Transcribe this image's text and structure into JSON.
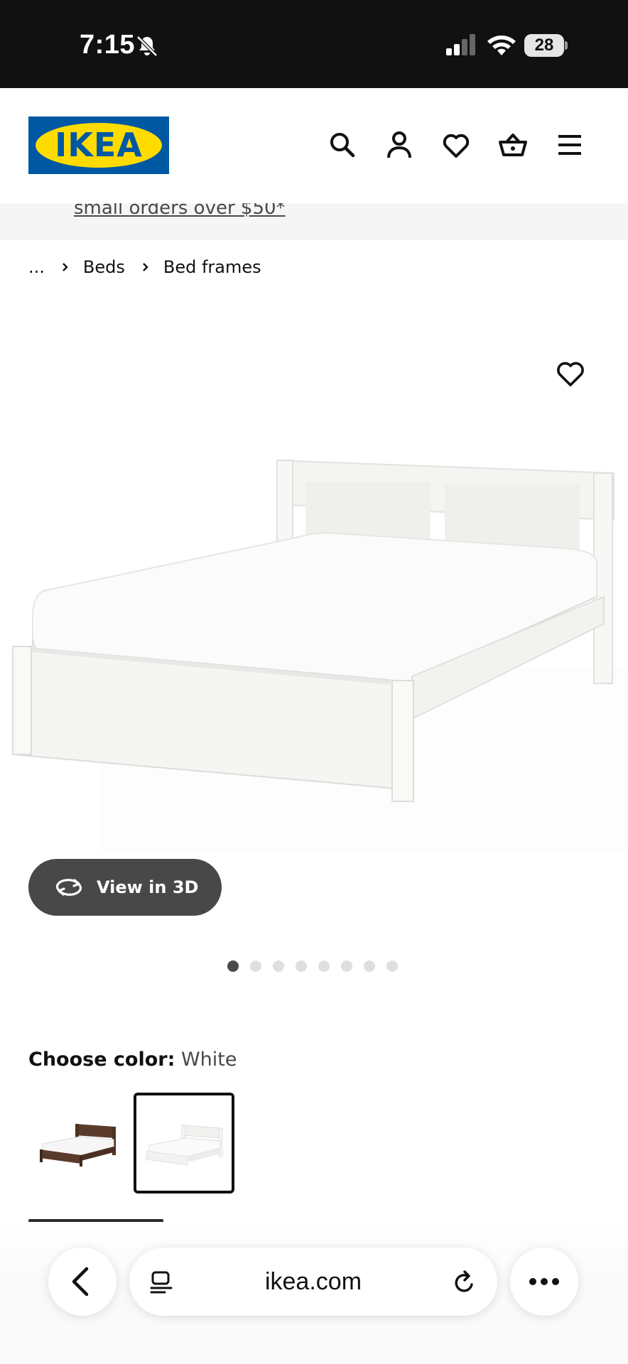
{
  "status_bar": {
    "time": "7:15",
    "battery": "28"
  },
  "header": {
    "logo_text": "IKEA",
    "icons": [
      "search-icon",
      "account-icon",
      "heart-icon",
      "shopping-basket-icon",
      "menu-icon"
    ]
  },
  "promo": {
    "text": "small orders over $50*"
  },
  "breadcrumb": {
    "items": [
      "...",
      "Beds",
      "Bed frames"
    ]
  },
  "product": {
    "view3d_label": "View in 3D",
    "carousel_total": 8,
    "carousel_active": 1
  },
  "color_picker": {
    "label": "Choose color:",
    "value": "White",
    "options": [
      "brown",
      "white"
    ],
    "selected": "white"
  },
  "browser": {
    "url": "ikea.com"
  },
  "colors": {
    "ikea_blue": "#0058a3",
    "ikea_yellow": "#ffdb00",
    "dark_button": "#484848"
  }
}
